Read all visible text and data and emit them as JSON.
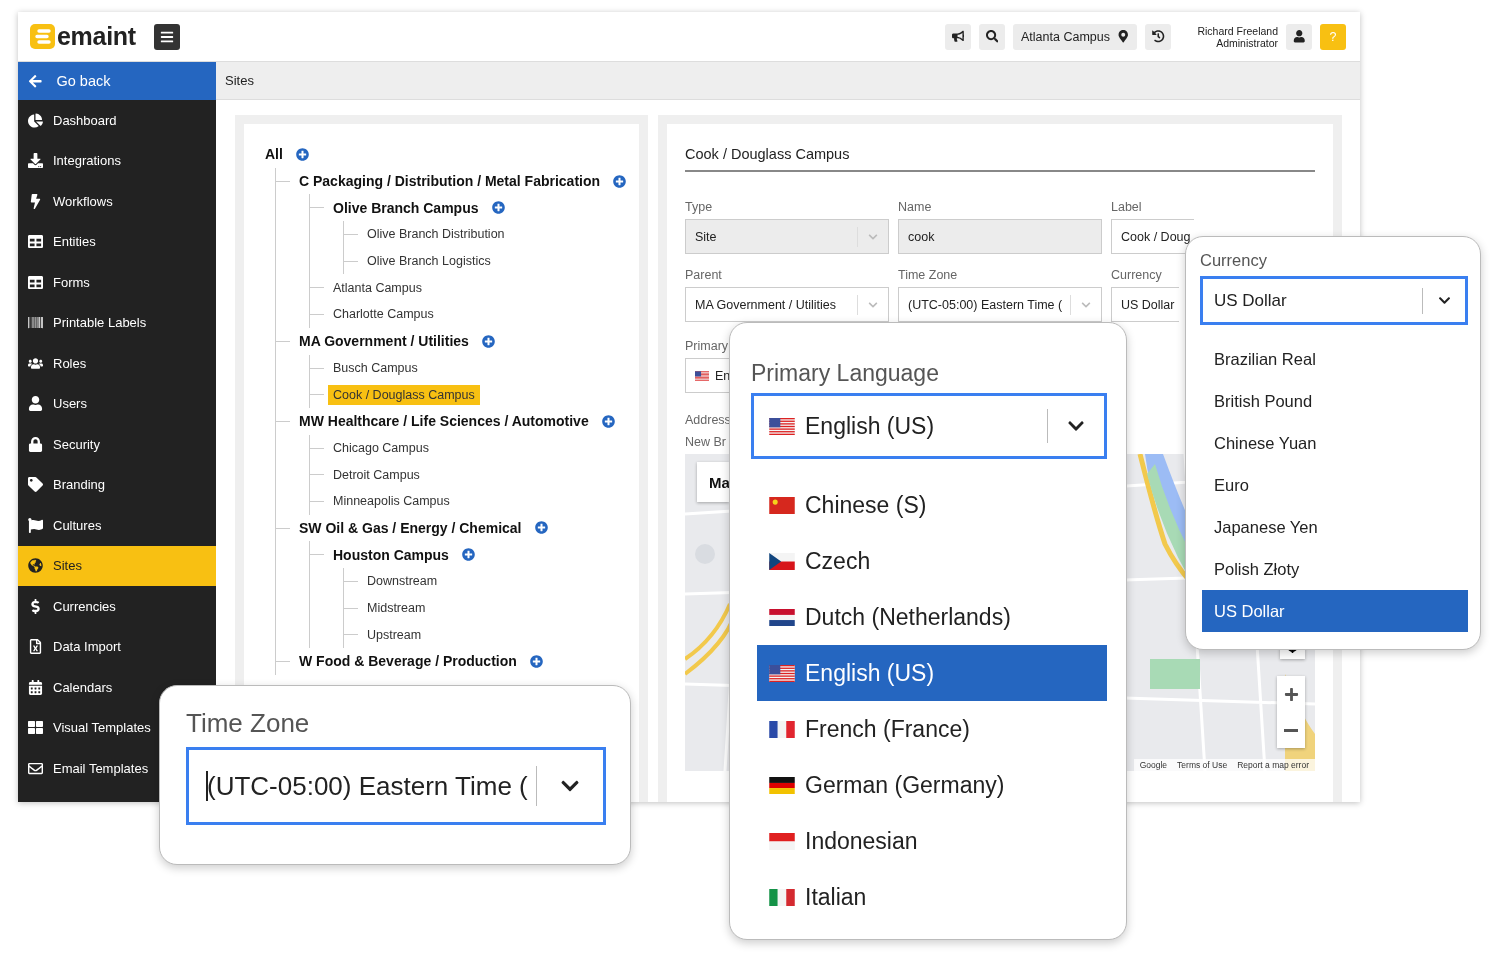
{
  "header": {
    "logo": "emaint",
    "location": "Atlanta Campus",
    "user": {
      "name": "Richard Freeland",
      "role": "Administrator"
    },
    "help": "?"
  },
  "sidebar": {
    "back": "Go back",
    "items": [
      {
        "label": "Dashboard",
        "selected": false
      },
      {
        "label": "Integrations",
        "selected": false
      },
      {
        "label": "Workflows",
        "selected": false
      },
      {
        "label": "Entities",
        "selected": false
      },
      {
        "label": "Forms",
        "selected": false
      },
      {
        "label": "Printable Labels",
        "selected": false
      },
      {
        "label": "Roles",
        "selected": false
      },
      {
        "label": "Users",
        "selected": false
      },
      {
        "label": "Security",
        "selected": false
      },
      {
        "label": "Branding",
        "selected": false
      },
      {
        "label": "Cultures",
        "selected": false
      },
      {
        "label": "Sites",
        "selected": true
      },
      {
        "label": "Currencies",
        "selected": false
      },
      {
        "label": "Data Import",
        "selected": false
      },
      {
        "label": "Calendars",
        "selected": false
      },
      {
        "label": "Visual Templates",
        "selected": false
      },
      {
        "label": "Email Templates",
        "selected": false
      }
    ]
  },
  "breadcrumb": "Sites",
  "tree": {
    "label": "All",
    "kind": "group",
    "selected": false,
    "children": [
      {
        "label": "C Packaging / Distribution / Metal Fabrication",
        "kind": "group",
        "selected": false,
        "children": [
          {
            "label": "Olive Branch Campus",
            "kind": "group",
            "selected": false,
            "children": [
              {
                "label": "Olive Branch Distribution",
                "kind": "site",
                "selected": false
              },
              {
                "label": "Olive Branch Logistics",
                "kind": "site",
                "selected": false
              }
            ]
          },
          {
            "label": "Atlanta Campus",
            "kind": "site",
            "selected": false
          },
          {
            "label": "Charlotte Campus",
            "kind": "site",
            "selected": false
          }
        ]
      },
      {
        "label": "MA Government / Utilities",
        "kind": "group",
        "selected": false,
        "children": [
          {
            "label": "Busch Campus",
            "kind": "site",
            "selected": false
          },
          {
            "label": "Cook / Douglass Campus",
            "kind": "site",
            "selected": true
          }
        ]
      },
      {
        "label": "MW Healthcare / Life Sciences / Automotive",
        "kind": "group",
        "selected": false,
        "children": [
          {
            "label": "Chicago Campus",
            "kind": "site",
            "selected": false
          },
          {
            "label": "Detroit Campus",
            "kind": "site",
            "selected": false
          },
          {
            "label": "Minneapolis Campus",
            "kind": "site",
            "selected": false
          }
        ]
      },
      {
        "label": "SW Oil & Gas / Energy / Chemical",
        "kind": "group",
        "selected": false,
        "children": [
          {
            "label": "Houston Campus",
            "kind": "group",
            "selected": false,
            "children": [
              {
                "label": "Downstream",
                "kind": "site",
                "selected": false
              },
              {
                "label": "Midstream",
                "kind": "site",
                "selected": false
              },
              {
                "label": "Upstream",
                "kind": "site",
                "selected": false
              }
            ]
          }
        ]
      },
      {
        "label": "W Food & Beverage / Production",
        "kind": "group",
        "selected": false
      }
    ]
  },
  "form": {
    "title": "Cook / Douglass Campus",
    "fields": [
      {
        "label": "Type",
        "value": "Site",
        "kind": "select",
        "disabled": true
      },
      {
        "label": "Name",
        "value": "cook",
        "kind": "text",
        "disabled": true
      },
      {
        "label": "Label",
        "value": "Cook / Doug",
        "kind": "text",
        "disabled": false
      },
      {
        "label": "Parent",
        "value": "MA Government / Utilities",
        "kind": "select",
        "disabled": false
      },
      {
        "label": "Time Zone",
        "value": "(UTC-05:00) Eastern Time (",
        "kind": "select",
        "disabled": false
      },
      {
        "label": "Currency",
        "value": "US Dollar",
        "kind": "text",
        "disabled": false
      }
    ],
    "primary": {
      "label": "Primary",
      "value": "En"
    },
    "address": {
      "label": "Address",
      "value": "New Br"
    },
    "map": {
      "map_button": "Ma",
      "attribution": [
        "Google",
        "Terms of Use",
        "Report a map error"
      ]
    }
  },
  "timezone_popup": {
    "label": "Time Zone",
    "value": "(UTC-05:00) Eastern Time ("
  },
  "language_popup": {
    "label": "Primary Language",
    "value": "English (US)",
    "options": [
      {
        "label": "Chinese (S)",
        "selected": false
      },
      {
        "label": "Czech",
        "selected": false
      },
      {
        "label": "Dutch (Netherlands)",
        "selected": false
      },
      {
        "label": "English (US)",
        "selected": true
      },
      {
        "label": "French (France)",
        "selected": false
      },
      {
        "label": "German (Germany)",
        "selected": false
      },
      {
        "label": "Indonesian",
        "selected": false
      },
      {
        "label": "Italian",
        "selected": false
      }
    ]
  },
  "currency_popup": {
    "label": "Currency",
    "value": "US Dollar",
    "options": [
      {
        "label": "Brazilian Real",
        "selected": false
      },
      {
        "label": "British Pound",
        "selected": false
      },
      {
        "label": "Chinese Yuan",
        "selected": false
      },
      {
        "label": "Euro",
        "selected": false
      },
      {
        "label": "Japanese Yen",
        "selected": false
      },
      {
        "label": "Polish Złoty",
        "selected": false
      },
      {
        "label": "US Dollar",
        "selected": true
      }
    ]
  }
}
